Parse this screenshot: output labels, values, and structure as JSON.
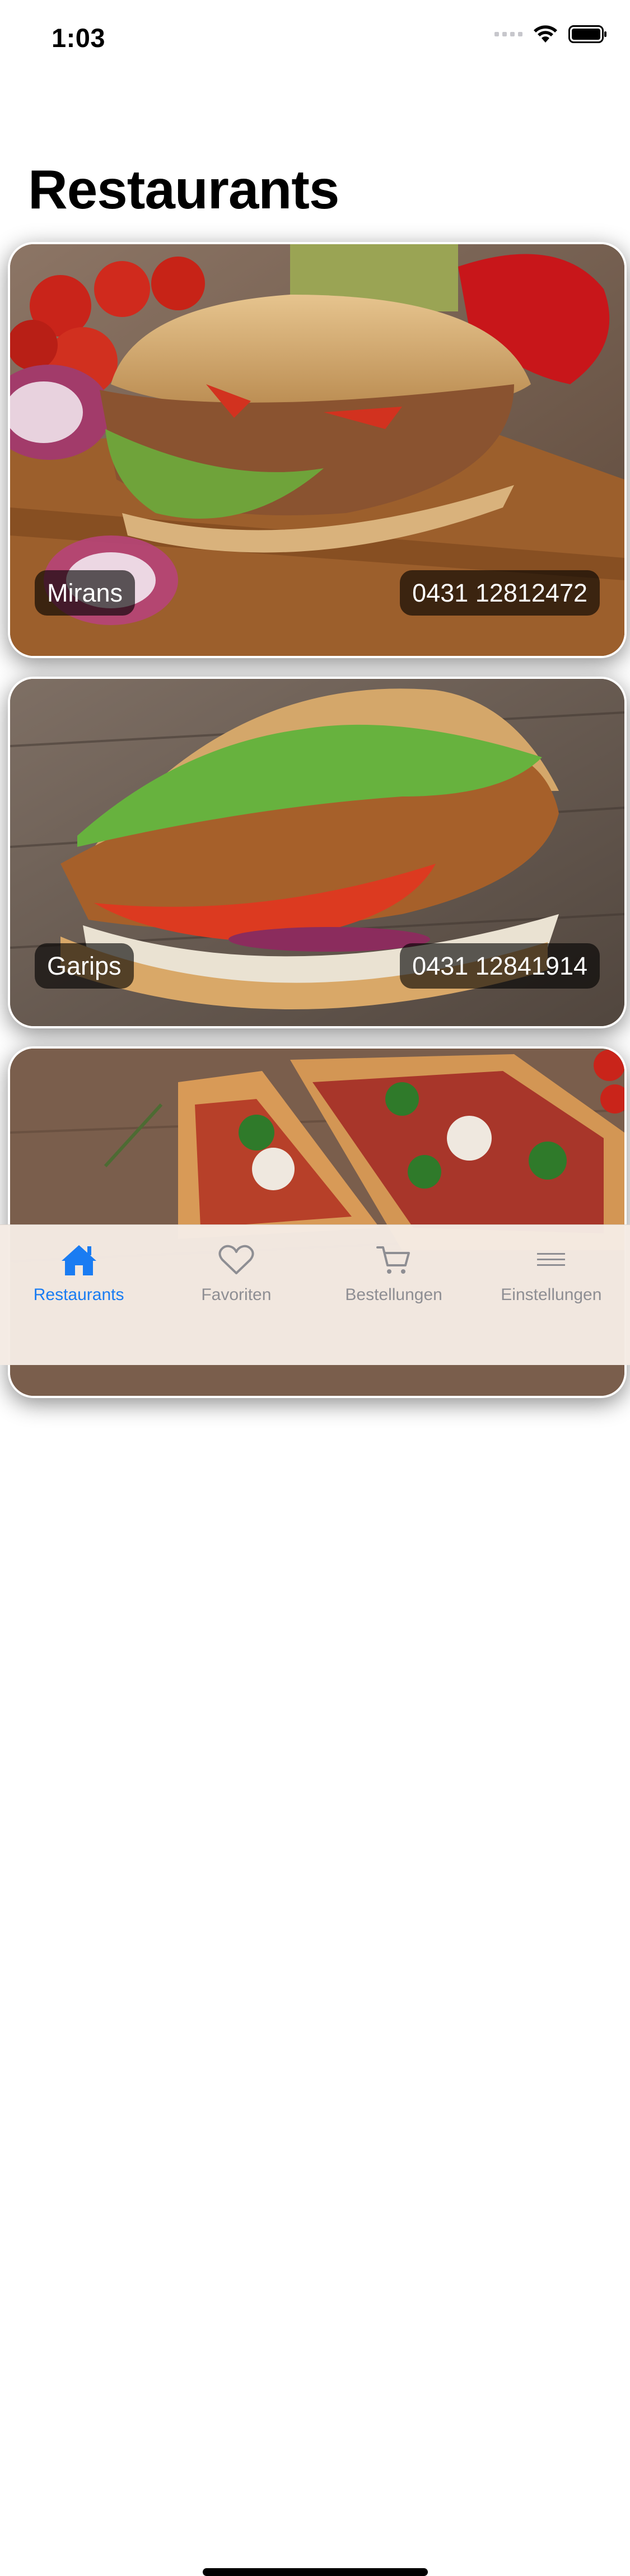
{
  "status_bar": {
    "time": "1:03"
  },
  "page_title": "Restaurants",
  "restaurants": [
    {
      "name": "Mirans",
      "phone": "0431 12812472",
      "image": "doener-sandwich-photo"
    },
    {
      "name": "Garips",
      "phone": "0431 12841914",
      "image": "doener-pita-photo"
    },
    {
      "name": "",
      "phone": "",
      "image": "pizza-photo"
    }
  ],
  "tab_bar": {
    "active_color": "#1a7cf2",
    "inactive_color": "#8e8e93",
    "tabs": [
      {
        "label": "Restaurants",
        "icon": "house-icon",
        "active": true
      },
      {
        "label": "Favoriten",
        "icon": "heart-icon",
        "active": false
      },
      {
        "label": "Bestellungen",
        "icon": "cart-icon",
        "active": false
      },
      {
        "label": "Einstellungen",
        "icon": "menu-icon",
        "active": false
      }
    ]
  }
}
